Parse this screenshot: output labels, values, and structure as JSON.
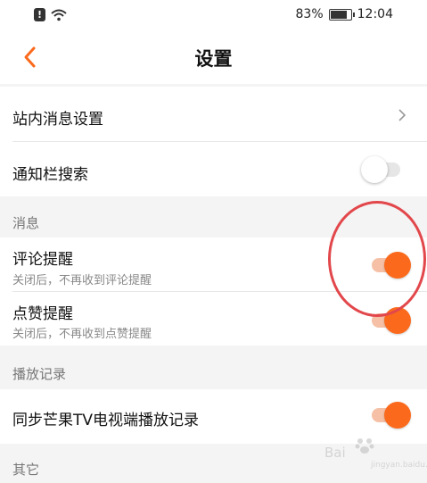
{
  "statusbar": {
    "battery_percent": "83%",
    "time": "12:04",
    "alert_glyph": "!"
  },
  "header": {
    "title": "设置"
  },
  "rows": {
    "station_msg": "站内消息设置",
    "notif_search": "通知栏搜索",
    "comment_remind": "评论提醒",
    "comment_remind_sub": "关闭后，不再收到评论提醒",
    "like_remind": "点赞提醒",
    "like_remind_sub": "关闭后，不再收到点赞提醒",
    "sync_history": "同步芒果TV电视端播放记录"
  },
  "toggles": {
    "notif_search": false,
    "comment_remind": true,
    "like_remind": true,
    "sync_history": true
  },
  "sections": {
    "messages": "消息",
    "history": "播放记录",
    "other": "其它"
  },
  "watermark": {
    "brand": "Bai",
    "sub": "jingyan.baidu.com"
  },
  "colors": {
    "accent": "#fb6a1c",
    "annotation": "#e2474b"
  },
  "icons": {
    "back": "chevron-left-icon",
    "row_more": "chevron-right-icon",
    "wifi": "wifi-icon",
    "battery": "battery-icon"
  }
}
